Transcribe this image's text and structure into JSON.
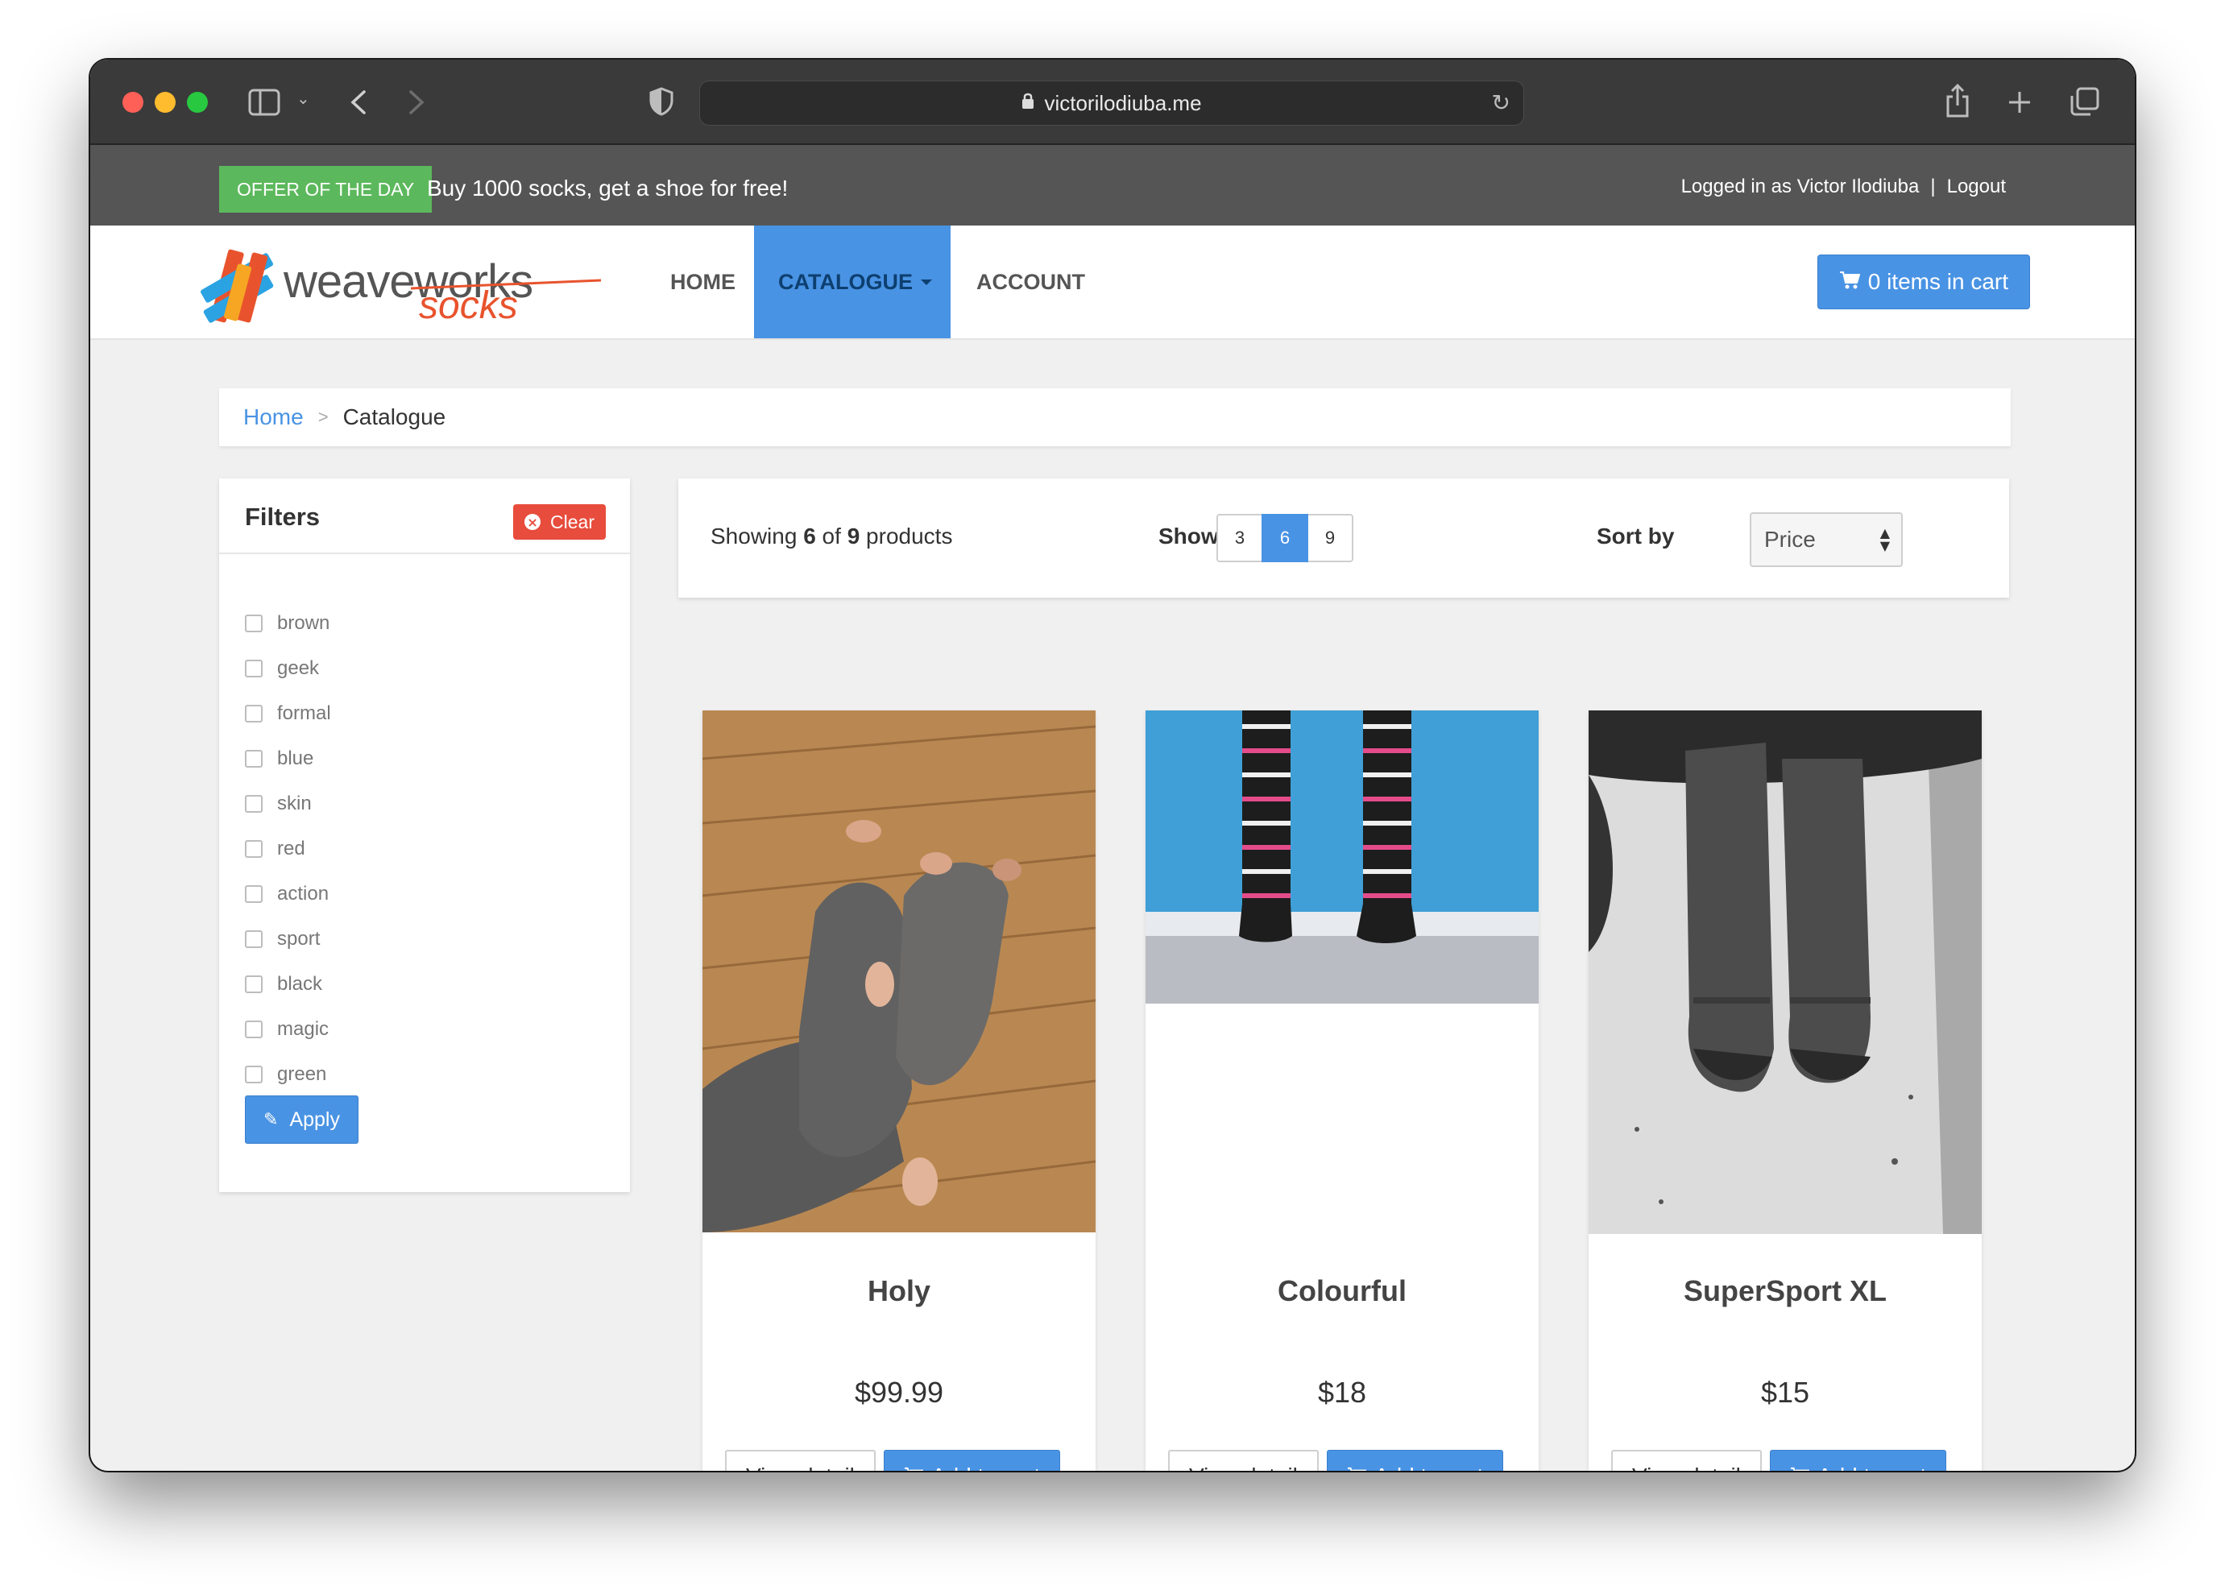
{
  "browser": {
    "url": "victorilodiuba.me"
  },
  "offer": {
    "badge": "OFFER OF THE DAY",
    "text": "Buy 1000 socks, get a shoe for free!"
  },
  "user": {
    "logged_in_text": "Logged in as Victor Ilodiuba",
    "separator": "|",
    "logout": "Logout"
  },
  "logo": {
    "part1": "weaveworks",
    "part2": "socks"
  },
  "nav": {
    "home": "HOME",
    "catalogue": "CATALOGUE",
    "account": "ACCOUNT"
  },
  "cart": {
    "label": "0 items in cart"
  },
  "breadcrumb": {
    "home": "Home",
    "separator": ">",
    "current": "Catalogue"
  },
  "filters": {
    "title": "Filters",
    "clear": "Clear",
    "apply": "Apply",
    "items": [
      "brown",
      "geek",
      "formal",
      "blue",
      "skin",
      "red",
      "action",
      "sport",
      "black",
      "magic",
      "green"
    ]
  },
  "controls": {
    "showing_prefix": "Showing",
    "showing_count": "6",
    "showing_of": "of",
    "showing_total": "9",
    "showing_suffix": "products",
    "show_label": "Show",
    "page_sizes": [
      "3",
      "6",
      "9"
    ],
    "active_page_size": "6",
    "sort_label": "Sort by",
    "sort_value": "Price"
  },
  "products": [
    {
      "name": "Holy",
      "price": "$99.99",
      "view": "View detail",
      "add": "Add to cart"
    },
    {
      "name": "Colourful",
      "price": "$18",
      "view": "View detail",
      "add": "Add to cart"
    },
    {
      "name": "SuperSport XL",
      "price": "$15",
      "view": "View detail",
      "add": "Add to cart"
    }
  ],
  "colors": {
    "primary": "#4993e4",
    "success": "#5cb85c",
    "danger": "#e74c3c",
    "offer_bar": "#555555",
    "brand_orange": "#e8532d"
  }
}
